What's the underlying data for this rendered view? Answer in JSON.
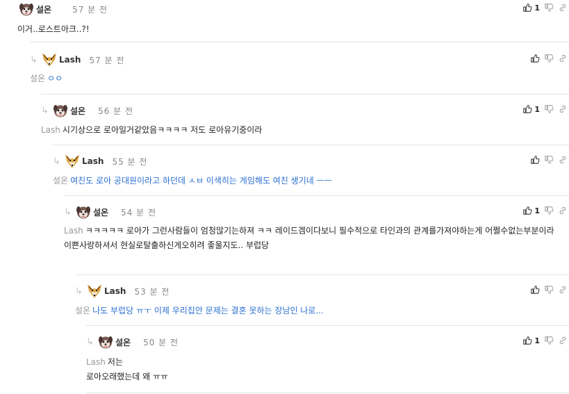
{
  "comments": [
    {
      "author": "설온",
      "time": "57 분 전",
      "likes": "1",
      "mention": "",
      "text": "이거..로스트아크..?!",
      "text2": ""
    },
    {
      "author": "Lash",
      "time": "57 분 전",
      "likes": "",
      "mention": "설온",
      "text": "ㅇㅇ",
      "text2": ""
    },
    {
      "author": "설온",
      "time": "56 분 전",
      "likes": "1",
      "mention": "Lash",
      "text": "시기상으로 로아일거같았음ㅋㅋㅋㅋ 저도 로아유기중이라",
      "text2": ""
    },
    {
      "author": "Lash",
      "time": "55 분 전",
      "likes": "",
      "mention": "설온",
      "text": "여친도 로아 공대원이라고 하던데 ㅅㅂ 이색히는 게임해도 여친 생기네 ㅡㅡ",
      "text2": ""
    },
    {
      "author": "설온",
      "time": "54 분 전",
      "likes": "1",
      "mention": "Lash",
      "text": "ㅋㅋㅋㅋㅋ 로아가 그런사람들이 엄청많기는하져 ㅋㅋ 레이드겜이다보니 필수적으로 타인과의 관계를가져야하는게 어쩔수없는부분이라",
      "text2": "이쁜사랑하셔서 현실로탈출하신게오히려 좋울지도.. 부럽당"
    },
    {
      "author": "Lash",
      "time": "53 분 전",
      "likes": "",
      "mention": "설온",
      "text": "나도 부럽당 ㅠㅜ 이제 우리집안 문제는 결혼 못하는 장남인 나로...",
      "text2": ""
    },
    {
      "author": "설온",
      "time": "50 분 전",
      "likes": "1",
      "mention": "Lash",
      "text": "저는",
      "text2": "로아오래했는데 왜 ㅠㅠ"
    }
  ],
  "icons": {
    "thumbs_up": "thumbs-up-icon",
    "thumbs_down": "thumbs-down-icon",
    "link": "link-icon",
    "reply": "reply-arrow-icon"
  },
  "colors": {
    "mention": "#999999",
    "reply_text": "#2a6fd1",
    "divider": "#e3e3e3"
  }
}
